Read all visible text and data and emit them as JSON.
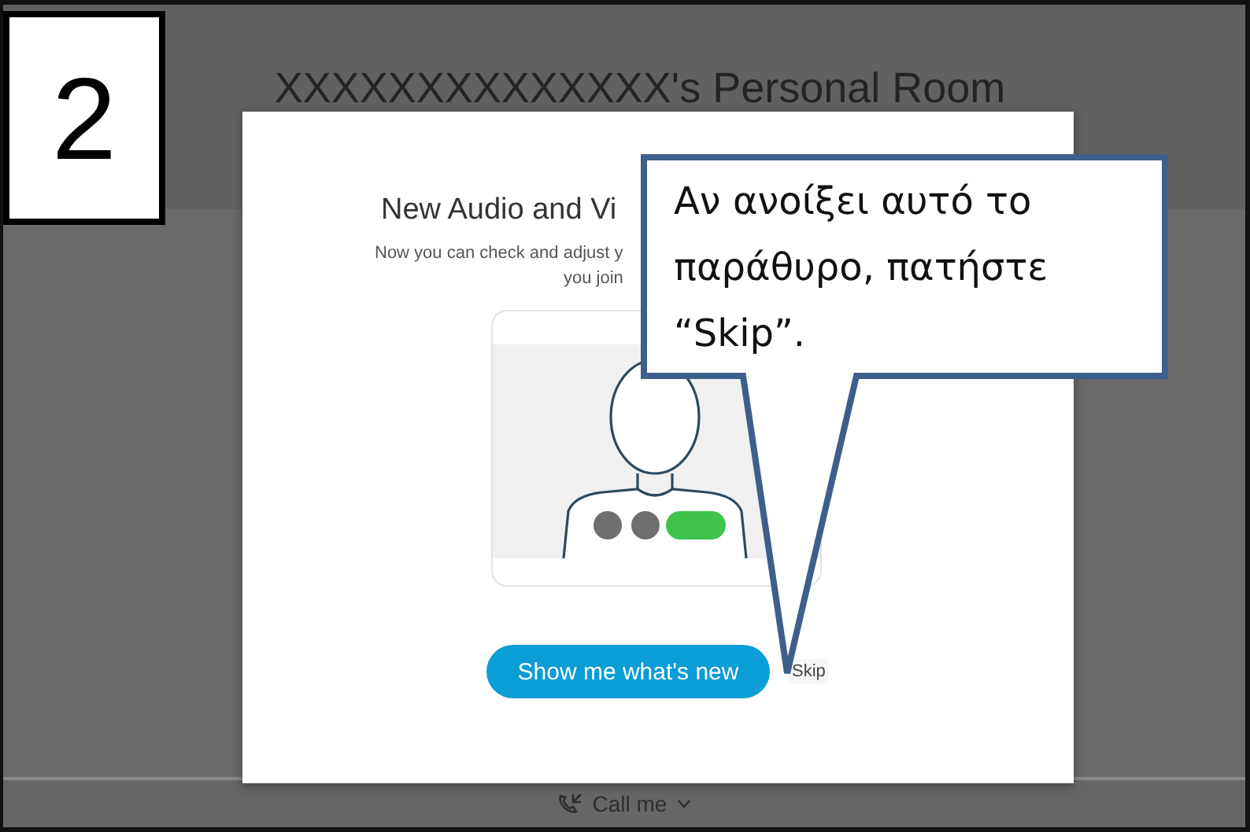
{
  "step_badge": "2",
  "backdrop": {
    "room_title": "XXXXXXXXXXXXXX's Personal Room",
    "call_me": "Call me"
  },
  "dialog": {
    "title": "New Audio and Vi",
    "subtitle_lines": [
      "Now you can check and adjust y",
      "you join"
    ],
    "primary_button": "Show me what's new",
    "skip_link": "Skip"
  },
  "callout": {
    "text": "Αν ανοίξει αυτό το παράθυρο, πατήστε “Skip”."
  }
}
